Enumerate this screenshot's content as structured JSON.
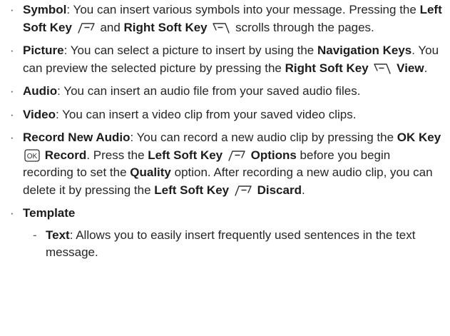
{
  "bullet_glyph": "·",
  "dash_glyph": "-",
  "symbol": {
    "title": "Symbol",
    "t1": ": You can insert various symbols into your message. Pressing the ",
    "left_key": "Left Soft Key",
    "t2": " and ",
    "right_key": "Right Soft Key",
    "t3": " scrolls through the pages."
  },
  "picture": {
    "title": "Picture",
    "t1": ": You can select a picture to insert by using the ",
    "nav_keys": "Navigation Keys",
    "t2": ". You can preview the selected picture by pressing the ",
    "right_key": "Right Soft Key",
    "view": "View",
    "t3": "."
  },
  "audio": {
    "title": "Audio",
    "t1": ": You can insert an audio file from your saved audio files."
  },
  "video": {
    "title": "Video",
    "t1": ": You can insert a video clip from your saved video clips."
  },
  "record": {
    "title": "Record New Audio",
    "t1": ": You can record a new audio clip by pressing the ",
    "ok_key": "OK Key",
    "ok_icon_text": "OK",
    "record": "Record",
    "t2": ". Press the ",
    "left_key_1": "Left Soft Key",
    "options": "Options",
    "t3": " before you begin recording to set the ",
    "quality": "Quality",
    "t4": " option. After recording a new audio clip, you can delete it by pressing the ",
    "left_key_2": "Left Soft Key",
    "discard": "Discard",
    "t5": "."
  },
  "template": {
    "title": "Template",
    "text_item": {
      "title": "Text",
      "t1": ": Allows you to easily insert frequently used sentences in the text message."
    }
  }
}
